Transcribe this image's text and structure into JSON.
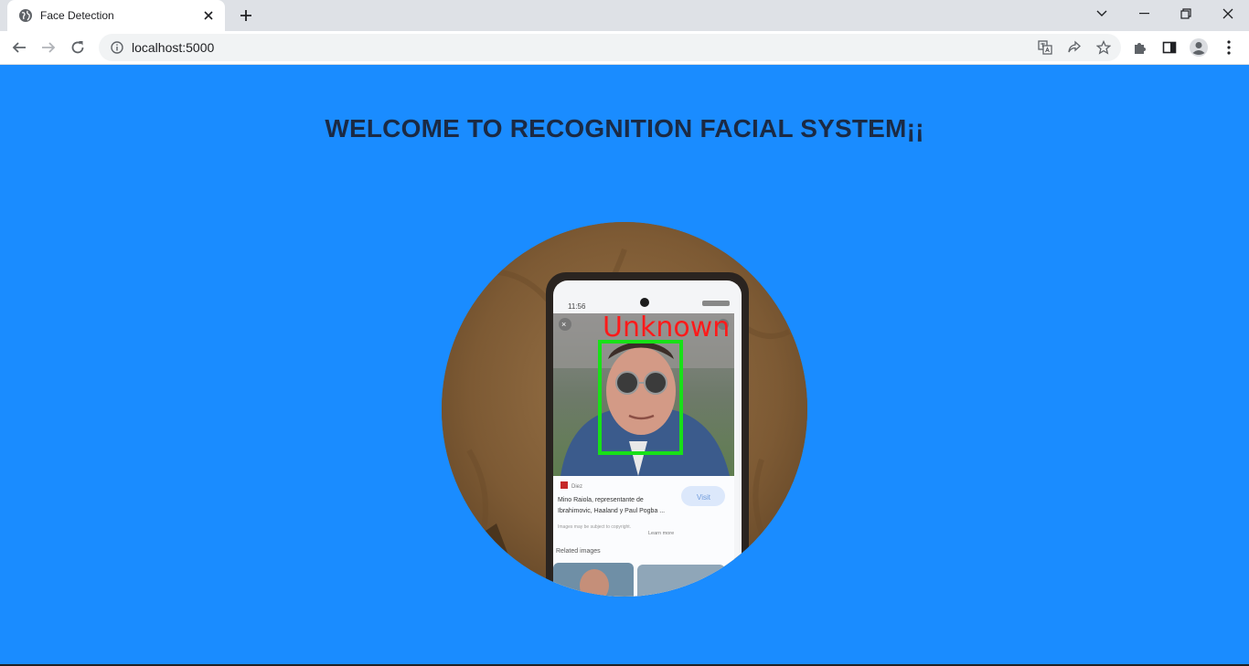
{
  "browser": {
    "tab": {
      "title": "Face Detection"
    },
    "address": {
      "url": "localhost:5000"
    },
    "icons": {
      "back": "arrow-left-icon",
      "forward": "arrow-right-icon",
      "reload": "reload-icon",
      "site_info": "info-icon",
      "translate": "translate-icon",
      "share": "share-icon",
      "bookmark": "star-icon",
      "extensions": "puzzle-icon",
      "side_panel": "side-panel-icon",
      "profile": "profile-icon",
      "menu": "kebab-menu-icon"
    }
  },
  "page": {
    "heading": "WELCOME TO RECOGNITION FACIAL SYSTEM¡¡",
    "video": {
      "detection_label": "Unknown",
      "phone_screen": {
        "status_time": "11:56",
        "source": "Diez",
        "caption_line1": "Mino Raiola, representante de",
        "caption_line2": "Ibrahimovic, Haaland y Paul Pogba ...",
        "visit_button": "Visit",
        "copyright_note": "Images may be subject to copyright.",
        "learn_more": "Learn more",
        "related": "Related images"
      }
    }
  },
  "colors": {
    "page_background": "#1a8cff",
    "detection_box": "#18e018",
    "detection_label": "#ff1a1a"
  }
}
